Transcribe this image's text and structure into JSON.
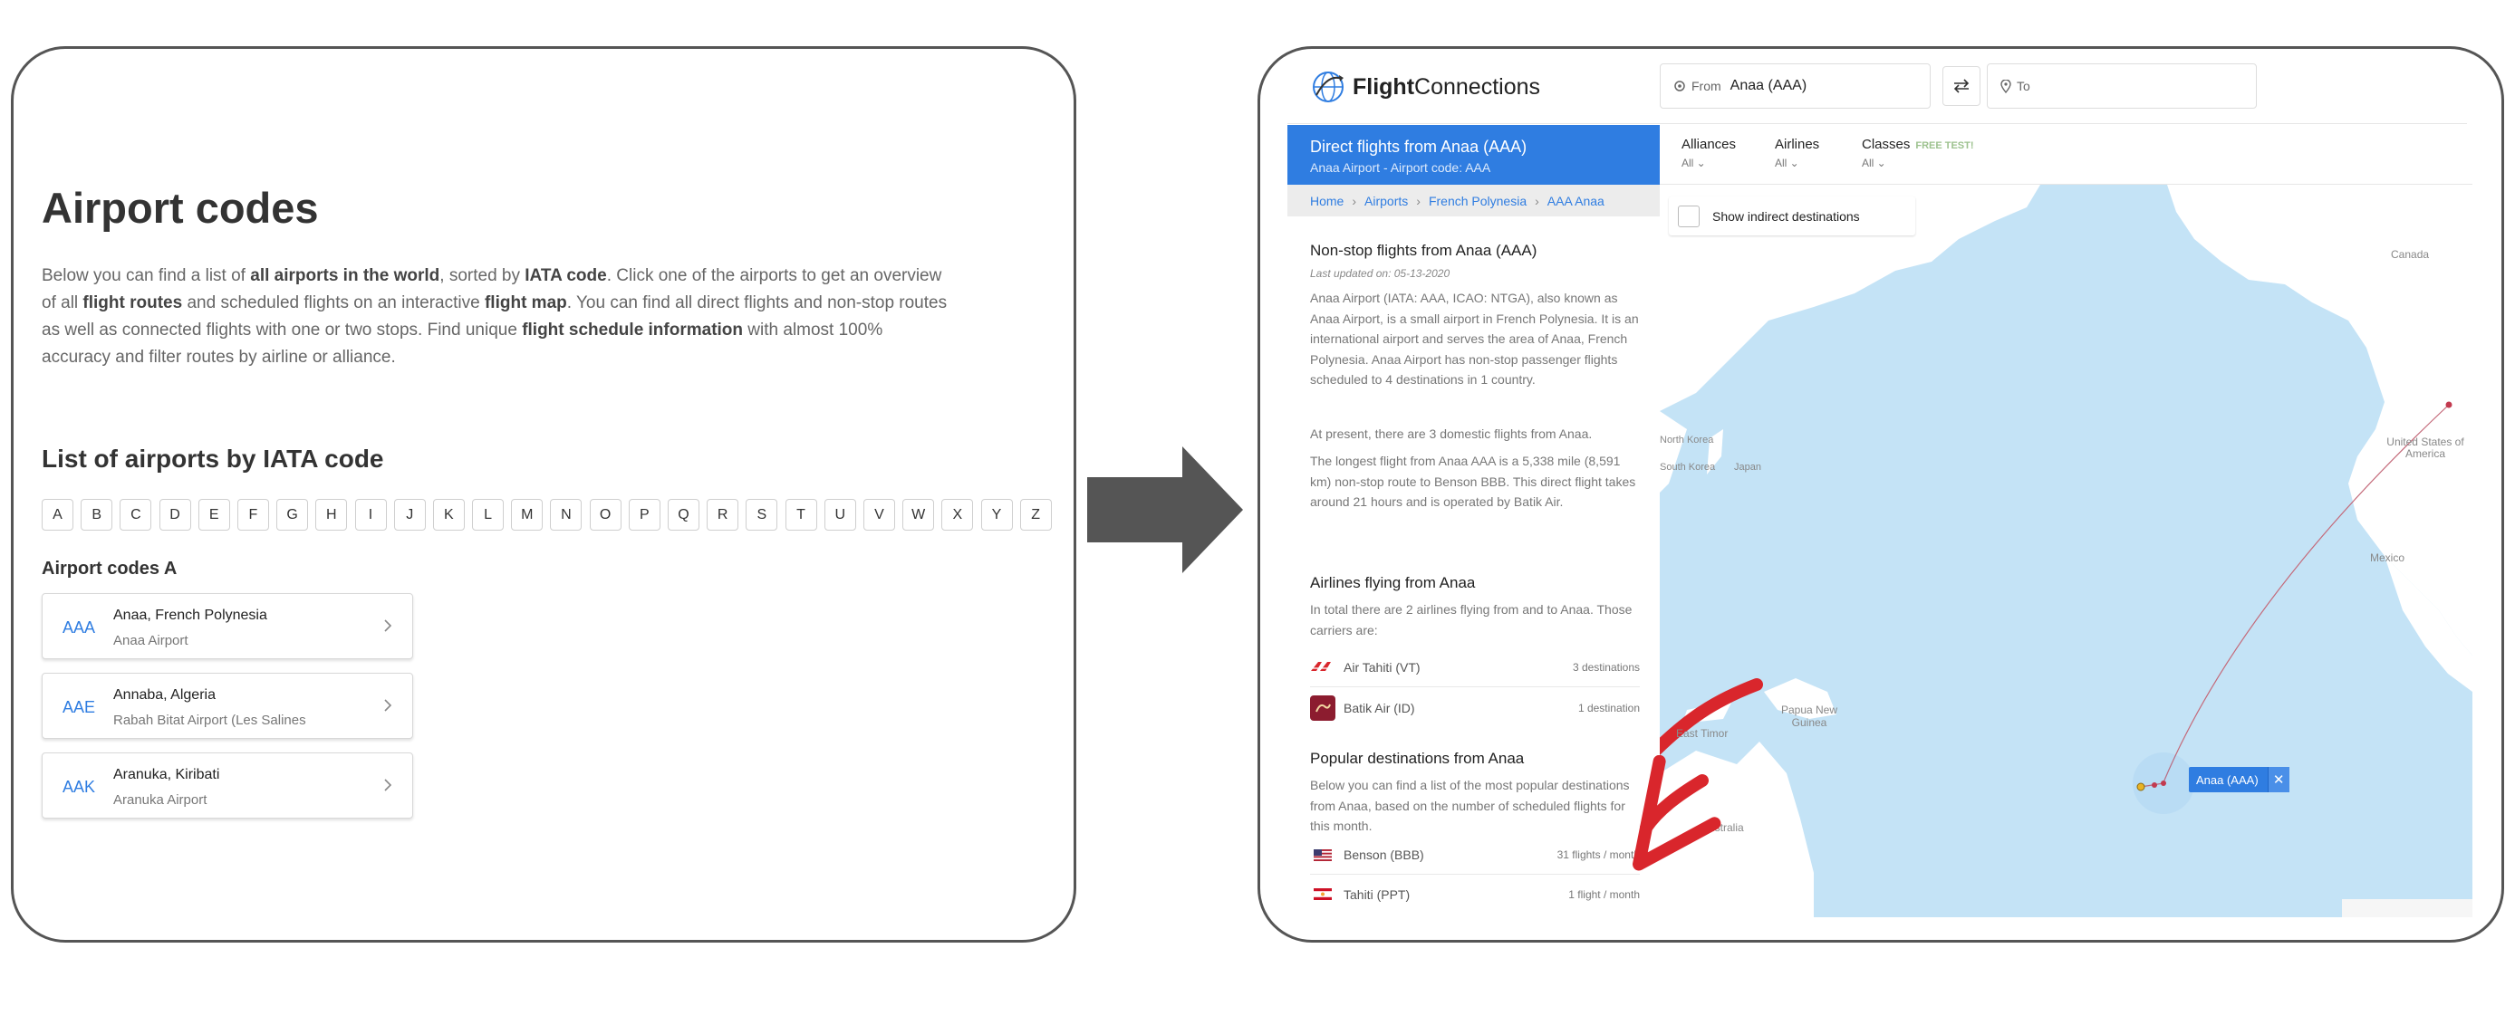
{
  "left": {
    "title": "Airport codes",
    "intro": [
      {
        "t": "Below you can find a list of ",
        "b": false
      },
      {
        "t": "all airports in the world",
        "b": true
      },
      {
        "t": ", sorted by ",
        "b": false
      },
      {
        "t": "IATA code",
        "b": true
      },
      {
        "t": ". Click one of the airports to get an overview of all ",
        "b": false
      },
      {
        "t": "flight routes",
        "b": true
      },
      {
        "t": " and scheduled flights on an interactive ",
        "b": false
      },
      {
        "t": "flight map",
        "b": true
      },
      {
        "t": ". You can find all direct flights and non-stop routes as well as connected flights with one or two stops. Find unique ",
        "b": false
      },
      {
        "t": "flight schedule information",
        "b": true
      },
      {
        "t": " with almost 100% accuracy and filter routes by airline or alliance.",
        "b": false
      }
    ],
    "list_title": "List of airports by IATA code",
    "letters": [
      "A",
      "B",
      "C",
      "D",
      "E",
      "F",
      "G",
      "H",
      "I",
      "J",
      "K",
      "L",
      "M",
      "N",
      "O",
      "P",
      "Q",
      "R",
      "S",
      "T",
      "U",
      "V",
      "W",
      "X",
      "Y",
      "Z"
    ],
    "codes_heading": "Airport codes A",
    "airports": [
      {
        "code": "AAA",
        "name": "Anaa, French Polynesia",
        "airport": "Anaa Airport"
      },
      {
        "code": "AAE",
        "name": "Annaba, Algeria",
        "airport": "Rabah Bitat Airport (Les Salines"
      },
      {
        "code": "AAK",
        "name": "Aranuka, Kiribati",
        "airport": "Aranuka Airport"
      }
    ]
  },
  "right": {
    "brand_bold": "Flight",
    "brand_rest": "Connections",
    "from_label": "From",
    "from_value": "Anaa (AAA)",
    "to_label": "To",
    "header_title": "Direct flights from Anaa (AAA)",
    "header_sub": "Anaa Airport - Airport code: AAA",
    "breadcrumbs": [
      "Home",
      "Airports",
      "French Polynesia",
      "AAA Anaa"
    ],
    "nonstop_title": "Non-stop flights from Anaa (AAA)",
    "updated": "Last updated on: 05-13-2020",
    "para1": "Anaa Airport (IATA: AAA, ICAO: NTGA), also known as Anaa Airport, is a small airport in French Polynesia. It is an international airport and serves the area of Anaa, French Polynesia. Anaa Airport has non-stop passenger flights scheduled to 4 destinations in 1 country.",
    "para2": "At present, there are 3 domestic flights from Anaa.",
    "para3": "The longest flight from Anaa AAA is a 5,338 mile (8,591 km) non-stop route to Benson BBB. This direct flight takes around 21 hours and is operated by Batik Air.",
    "airlines_title": "Airlines flying from Anaa",
    "airlines_intro": "In total there are 2 airlines flying from and to Anaa. Those carriers are:",
    "airlines": [
      {
        "name": "Air Tahiti (VT)",
        "count": "3 destinations",
        "icon": "air-tahiti-logo"
      },
      {
        "name": "Batik Air (ID)",
        "count": "1 destination",
        "icon": "batik-air-logo"
      }
    ],
    "popular_title": "Popular destinations from Anaa",
    "popular_intro": "Below you can find a list of the most popular destinations from Anaa, based on the number of scheduled flights for this month.",
    "destinations": [
      {
        "name": "Benson (BBB)",
        "freq": "31 flights / month",
        "icon": "us-flag-icon"
      },
      {
        "name": "Tahiti (PPT)",
        "freq": "1 flight / month",
        "icon": "french-polynesia-flag-icon"
      }
    ],
    "filters": [
      {
        "name": "Alliances",
        "value": "All",
        "tag": ""
      },
      {
        "name": "Airlines",
        "value": "All",
        "tag": ""
      },
      {
        "name": "Classes",
        "value": "All",
        "tag": "FREE TEST!"
      }
    ],
    "show_indirect": "Show indirect destinations",
    "map_labels": [
      "Canada",
      "United States of America",
      "Mexico",
      "North Korea",
      "South Korea",
      "Japan",
      "Papua New Guinea",
      "East Timor",
      "Australia"
    ],
    "pin_label": "Anaa (AAA)",
    "pin_close": "✕"
  },
  "colors": {
    "accent": "#2f7de1",
    "map_water": "#c4e3f6",
    "land": "#ffffff",
    "annotation_arrow": "#d9262c",
    "tag_green": "#9dc28f"
  }
}
